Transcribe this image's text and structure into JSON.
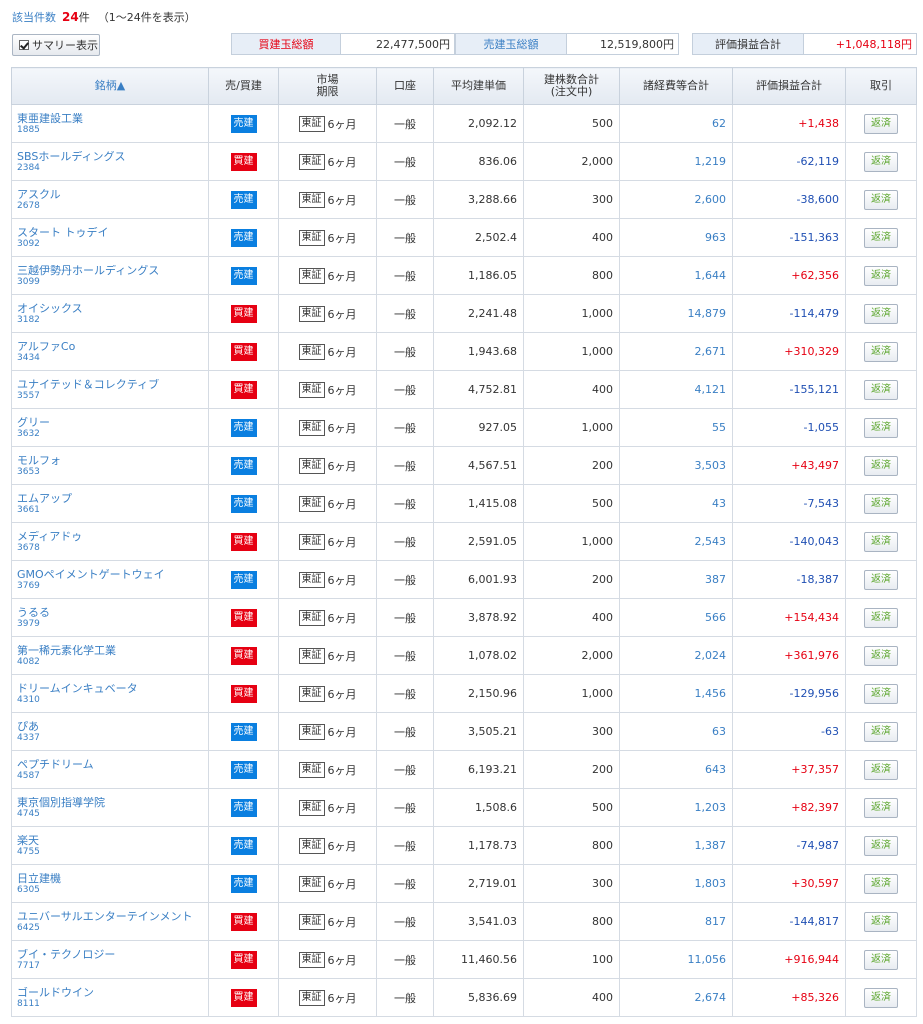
{
  "header": {
    "count_label": "該当件数",
    "count": "24",
    "count_unit": "件",
    "range": "（1〜24件を表示）"
  },
  "summary_toggle": {
    "label": "サマリー表示",
    "checked": true
  },
  "summary": {
    "buy_label": "買建玉総額",
    "buy_value": "22,477,500円",
    "sell_label": "売建玉総額",
    "sell_value": "12,519,800円",
    "pl_label": "評価損益合計",
    "pl_value": "+1,048,118円"
  },
  "colors": {
    "buy": "#e60012",
    "sell": "#0a7fe0",
    "plus": "#e60012",
    "minus": "#1f4fb3",
    "link": "#3a7fc4"
  },
  "table": {
    "headers": {
      "name": "銘柄▲",
      "side": "売/買建",
      "market1": "市場",
      "market2": "期限",
      "account": "口座",
      "avg": "平均建単価",
      "qty1": "建株数合計",
      "qty2": "(注文中)",
      "fees": "諸経費等合計",
      "pl": "評価損益合計",
      "trade": "取引"
    },
    "rows": [
      {
        "name": "東亜建設工業",
        "code": "1885",
        "side": "売建",
        "market": "東証",
        "term": "6ヶ月",
        "account": "一般",
        "avg": "2,092.12",
        "qty": "500",
        "fees": "62",
        "pl": "+1,438"
      },
      {
        "name": "SBSホールディングス",
        "code": "2384",
        "side": "買建",
        "market": "東証",
        "term": "6ヶ月",
        "account": "一般",
        "avg": "836.06",
        "qty": "2,000",
        "fees": "1,219",
        "pl": "-62,119"
      },
      {
        "name": "アスクル",
        "code": "2678",
        "side": "売建",
        "market": "東証",
        "term": "6ヶ月",
        "account": "一般",
        "avg": "3,288.66",
        "qty": "300",
        "fees": "2,600",
        "pl": "-38,600"
      },
      {
        "name": "スタート トゥデイ",
        "code": "3092",
        "side": "売建",
        "market": "東証",
        "term": "6ヶ月",
        "account": "一般",
        "avg": "2,502.4",
        "qty": "400",
        "fees": "963",
        "pl": "-151,363"
      },
      {
        "name": "三越伊勢丹ホールディングス",
        "code": "3099",
        "side": "売建",
        "market": "東証",
        "term": "6ヶ月",
        "account": "一般",
        "avg": "1,186.05",
        "qty": "800",
        "fees": "1,644",
        "pl": "+62,356"
      },
      {
        "name": "オイシックス",
        "code": "3182",
        "side": "買建",
        "market": "東証",
        "term": "6ヶ月",
        "account": "一般",
        "avg": "2,241.48",
        "qty": "1,000",
        "fees": "14,879",
        "pl": "-114,479"
      },
      {
        "name": "アルファCo",
        "code": "3434",
        "side": "買建",
        "market": "東証",
        "term": "6ヶ月",
        "account": "一般",
        "avg": "1,943.68",
        "qty": "1,000",
        "fees": "2,671",
        "pl": "+310,329"
      },
      {
        "name": "ユナイテッド＆コレクティブ",
        "code": "3557",
        "side": "買建",
        "market": "東証",
        "term": "6ヶ月",
        "account": "一般",
        "avg": "4,752.81",
        "qty": "400",
        "fees": "4,121",
        "pl": "-155,121"
      },
      {
        "name": "グリー",
        "code": "3632",
        "side": "売建",
        "market": "東証",
        "term": "6ヶ月",
        "account": "一般",
        "avg": "927.05",
        "qty": "1,000",
        "fees": "55",
        "pl": "-1,055"
      },
      {
        "name": "モルフォ",
        "code": "3653",
        "side": "売建",
        "market": "東証",
        "term": "6ヶ月",
        "account": "一般",
        "avg": "4,567.51",
        "qty": "200",
        "fees": "3,503",
        "pl": "+43,497"
      },
      {
        "name": "エムアップ",
        "code": "3661",
        "side": "売建",
        "market": "東証",
        "term": "6ヶ月",
        "account": "一般",
        "avg": "1,415.08",
        "qty": "500",
        "fees": "43",
        "pl": "-7,543"
      },
      {
        "name": "メディアドゥ",
        "code": "3678",
        "side": "買建",
        "market": "東証",
        "term": "6ヶ月",
        "account": "一般",
        "avg": "2,591.05",
        "qty": "1,000",
        "fees": "2,543",
        "pl": "-140,043"
      },
      {
        "name": "GMOペイメントゲートウェイ",
        "code": "3769",
        "side": "売建",
        "market": "東証",
        "term": "6ヶ月",
        "account": "一般",
        "avg": "6,001.93",
        "qty": "200",
        "fees": "387",
        "pl": "-18,387"
      },
      {
        "name": "うるる",
        "code": "3979",
        "side": "買建",
        "market": "東証",
        "term": "6ヶ月",
        "account": "一般",
        "avg": "3,878.92",
        "qty": "400",
        "fees": "566",
        "pl": "+154,434"
      },
      {
        "name": "第一稀元素化学工業",
        "code": "4082",
        "side": "買建",
        "market": "東証",
        "term": "6ヶ月",
        "account": "一般",
        "avg": "1,078.02",
        "qty": "2,000",
        "fees": "2,024",
        "pl": "+361,976"
      },
      {
        "name": "ドリームインキュベータ",
        "code": "4310",
        "side": "買建",
        "market": "東証",
        "term": "6ヶ月",
        "account": "一般",
        "avg": "2,150.96",
        "qty": "1,000",
        "fees": "1,456",
        "pl": "-129,956"
      },
      {
        "name": "ぴあ",
        "code": "4337",
        "side": "売建",
        "market": "東証",
        "term": "6ヶ月",
        "account": "一般",
        "avg": "3,505.21",
        "qty": "300",
        "fees": "63",
        "pl": "-63"
      },
      {
        "name": "ペプチドリーム",
        "code": "4587",
        "side": "売建",
        "market": "東証",
        "term": "6ヶ月",
        "account": "一般",
        "avg": "6,193.21",
        "qty": "200",
        "fees": "643",
        "pl": "+37,357"
      },
      {
        "name": "東京個別指導学院",
        "code": "4745",
        "side": "売建",
        "market": "東証",
        "term": "6ヶ月",
        "account": "一般",
        "avg": "1,508.6",
        "qty": "500",
        "fees": "1,203",
        "pl": "+82,397"
      },
      {
        "name": "楽天",
        "code": "4755",
        "side": "売建",
        "market": "東証",
        "term": "6ヶ月",
        "account": "一般",
        "avg": "1,178.73",
        "qty": "800",
        "fees": "1,387",
        "pl": "-74,987"
      },
      {
        "name": "日立建機",
        "code": "6305",
        "side": "売建",
        "market": "東証",
        "term": "6ヶ月",
        "account": "一般",
        "avg": "2,719.01",
        "qty": "300",
        "fees": "1,803",
        "pl": "+30,597"
      },
      {
        "name": "ユニバーサルエンターテインメント",
        "code": "6425",
        "side": "買建",
        "market": "東証",
        "term": "6ヶ月",
        "account": "一般",
        "avg": "3,541.03",
        "qty": "800",
        "fees": "817",
        "pl": "-144,817"
      },
      {
        "name": "ブイ・テクノロジー",
        "code": "7717",
        "side": "買建",
        "market": "東証",
        "term": "6ヶ月",
        "account": "一般",
        "avg": "11,460.56",
        "qty": "100",
        "fees": "11,056",
        "pl": "+916,944"
      },
      {
        "name": "ゴールドウイン",
        "code": "8111",
        "side": "買建",
        "market": "東証",
        "term": "6ヶ月",
        "account": "一般",
        "avg": "5,836.69",
        "qty": "400",
        "fees": "2,674",
        "pl": "+85,326"
      }
    ],
    "action_label": "返済"
  }
}
